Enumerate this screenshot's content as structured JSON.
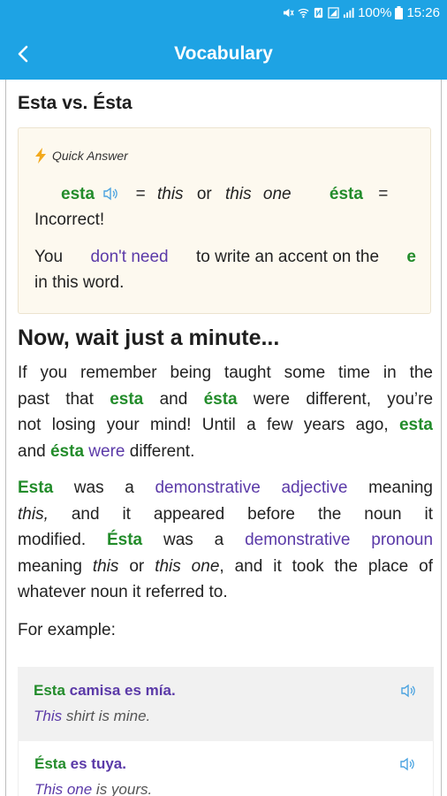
{
  "status": {
    "percent": "100%",
    "time": "15:26"
  },
  "appbar": {
    "title": "Vocabulary"
  },
  "article": {
    "heading": "Esta vs. Ésta",
    "quick_answer": {
      "label": "Quick Answer",
      "word1": "esta",
      "eq1": "=",
      "this": "this",
      "or": "or",
      "this_one_a": "this",
      "this_one_b": "one",
      "word2": "ésta",
      "eq2": "=",
      "incorrect": "Incorrect!",
      "l3_a": "You",
      "l3_link": "don't need",
      "l3_b": "to write an accent on the",
      "l3_e": "e",
      "l4": "in this word."
    },
    "section_title": "Now, wait just a minute...",
    "p1": {
      "l1": "If you remember being taught some time in the",
      "l2_a": "past that",
      "l2_w1": "esta",
      "l2_b": "and",
      "l2_w2": "ésta",
      "l2_c": "were different, you’re",
      "l3_a": "not losing your mind! Until a few years ago,",
      "l3_w": "esta",
      "l4_a": "and",
      "l4_w": "ésta",
      "l4_link": "were",
      "l4_b": "different."
    },
    "p2": {
      "l1_w": "Esta",
      "l1_a": "was a",
      "l1_link": "demonstrative adjective",
      "l1_b": "meaning",
      "l2_i": "this,",
      "l2_a": "and it appeared before the noun it",
      "l3_a": "modified.",
      "l3_w": "Ésta",
      "l3_b": "was a",
      "l3_link": "demonstrative pronoun",
      "l4_a": "meaning",
      "l4_i1": "this",
      "l4_b": "or",
      "l4_i2": "this one",
      "l4_c": ", and it took the place of",
      "l5": "whatever noun it referred to."
    },
    "for_example": "For example:",
    "examples": [
      {
        "es_a": "Esta",
        "es_b": " camisa es mía.",
        "en_a": "This",
        "en_b": " shirt is mine."
      },
      {
        "es_a": "Ésta",
        "es_b": " es tuya.",
        "en_a": "This one",
        "en_b": " is yours."
      }
    ]
  },
  "colors": {
    "appbar": "#1ea3e4",
    "green": "#238c2b",
    "purple": "#5b3aa8",
    "speaker": "#4aa3e0"
  },
  "icons": [
    "back-arrow-icon",
    "lightning-icon",
    "speaker-icon",
    "mute-icon",
    "wifi-icon",
    "signal-icon",
    "battery-icon"
  ]
}
